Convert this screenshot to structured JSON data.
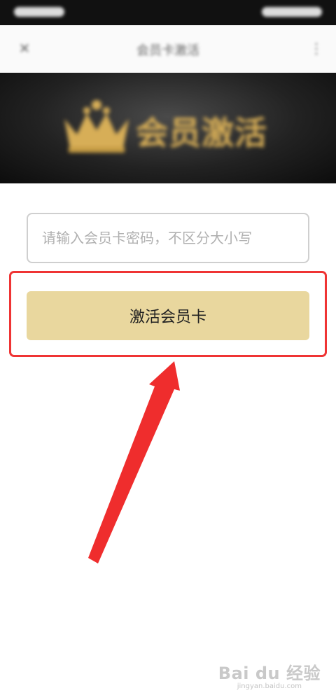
{
  "header": {
    "title": "会员卡激活"
  },
  "banner": {
    "text": "会员激活"
  },
  "form": {
    "placeholder": "请输入会员卡密码，不区分大小写",
    "value": "",
    "activate_label": "激活会员卡"
  },
  "watermark": {
    "logo": "Bai du 经验",
    "sub": "jingyan.baidu.com"
  },
  "colors": {
    "button": "#e9d79e",
    "highlight": "#ef3434",
    "banner_gold": "#d7ae57"
  }
}
